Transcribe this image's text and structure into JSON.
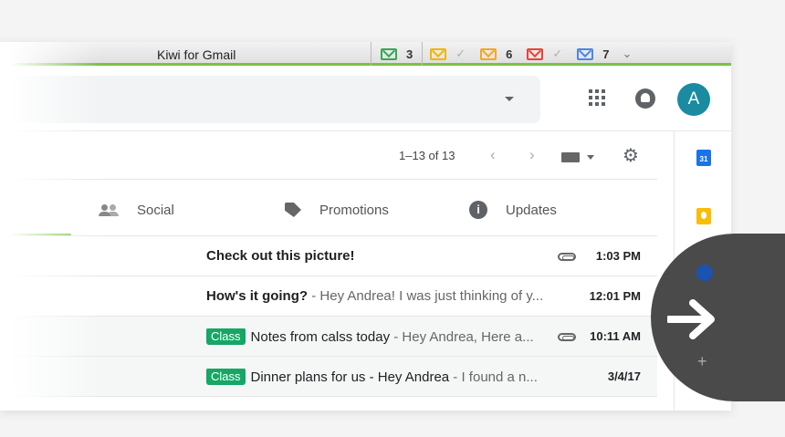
{
  "window": {
    "title": "Kiwi for Gmail"
  },
  "accounts": [
    {
      "color": "#34a853",
      "count": "3"
    },
    {
      "color": "#f4b400",
      "count": "✓"
    },
    {
      "color": "#f6a623",
      "count": "6"
    },
    {
      "color": "#ea4335",
      "count": "✓"
    },
    {
      "color": "#4a86e8",
      "count": "7"
    }
  ],
  "accounts_more_icon": "chevron-double-down-icon",
  "header": {
    "avatar_letter": "A",
    "avatar_color": "#1a8ba0"
  },
  "toolbar": {
    "pagination": "1–13 of 13",
    "prev": "‹",
    "next": "›",
    "settings_icon": "gear-icon"
  },
  "tabs": [
    {
      "label": "Social",
      "icon": "people-icon"
    },
    {
      "label": "Promotions",
      "icon": "tag-icon"
    },
    {
      "label": "Updates",
      "icon": "info-icon"
    }
  ],
  "emails": [
    {
      "label": "",
      "subject": "Check out this picture!",
      "snippet": "",
      "time": "1:03 PM",
      "attachment": true,
      "read": false
    },
    {
      "label": "",
      "subject": "How's it going?",
      "snippet": " - Hey Andrea! I was just thinking of y...",
      "time": "12:01 PM",
      "attachment": false,
      "read": false
    },
    {
      "label": "Class",
      "subject": "Notes from calss today",
      "snippet": " - Hey Andrea, Here a...",
      "time": "10:11 AM",
      "attachment": true,
      "read": true
    },
    {
      "label": "Class",
      "subject": "Dinner plans for us - Hey Andrea",
      "snippet": " - I found a n...",
      "time": "3/4/17",
      "attachment": false,
      "read": true
    }
  ],
  "side_panel": {
    "calendar_day": "31"
  },
  "colors": {
    "accent_green": "#79c143",
    "label_green": "#16a765"
  }
}
